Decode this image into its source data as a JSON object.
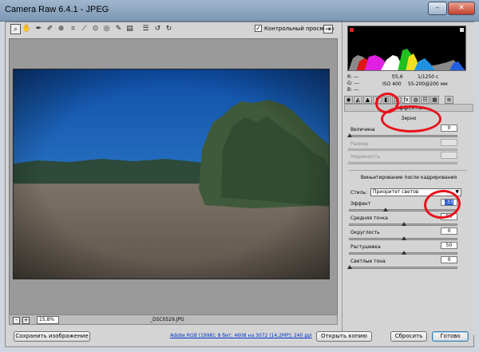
{
  "window": {
    "title": "Camera Raw 6.4.1  -  JPEG",
    "buttons": {
      "minimize": "–",
      "close": "✕"
    }
  },
  "toolbar": {
    "tools": [
      "zoom-icon",
      "hand-icon",
      "white-balance-icon",
      "color-sampler-icon",
      "target-adjust-icon",
      "crop-icon",
      "straighten-icon",
      "spot-removal-icon",
      "red-eye-icon",
      "adjustment-brush-icon",
      "graduated-filter-icon",
      "preferences-icon",
      "rotate-left-icon",
      "rotate-right-icon"
    ],
    "preview_label": "Контрольный просмотр",
    "preview_checked": "✓"
  },
  "status": {
    "zoom_minus": "-",
    "zoom_plus": "+",
    "zoom": "15,8%",
    "filename": "_DSC0529.JPG"
  },
  "info": {
    "r": "R:  ---",
    "g": "G:  ---",
    "b": "B:  ---",
    "aperture": "f/5,6",
    "shutter": "1/1250 с",
    "iso": "ISO  400",
    "lens": "55-200@200 мм"
  },
  "panel": {
    "section": "Эффекты",
    "grain": {
      "title": "Зерно",
      "sliders": [
        {
          "label": "Величина",
          "value": "0",
          "enabled": true,
          "pos": 0
        },
        {
          "label": "Размер",
          "value": "",
          "enabled": false,
          "pos": 0
        },
        {
          "label": "Неровность",
          "value": "",
          "enabled": false,
          "pos": 0
        }
      ]
    },
    "vignette": {
      "title": "Виньетирование после кадрирования",
      "style_label": "Стиль:",
      "style_value": "Приоритет светов",
      "sliders": [
        {
          "label": "Эффект",
          "value": "-33",
          "pos": 0.335
        },
        {
          "label": "Средняя точка",
          "value": "50",
          "pos": 0.5
        },
        {
          "label": "Округлость",
          "value": "0",
          "pos": 0.5
        },
        {
          "label": "Растушевка",
          "value": "50",
          "pos": 0.5
        },
        {
          "label": "Светлые тона",
          "value": "0",
          "pos": 0
        }
      ]
    }
  },
  "bottom": {
    "save": "Сохранить изображение",
    "workflow_link": "Adobe RGB (1998); 8 бит; 4608 на 3072 (14,2MP); 240 ppi",
    "open": "Открыть копию",
    "reset": "Сбросить",
    "done": "Готово"
  },
  "colors": {
    "annotation": "#e8121b",
    "selection": "#2a5bd1",
    "sky": "#1b6fc7"
  }
}
